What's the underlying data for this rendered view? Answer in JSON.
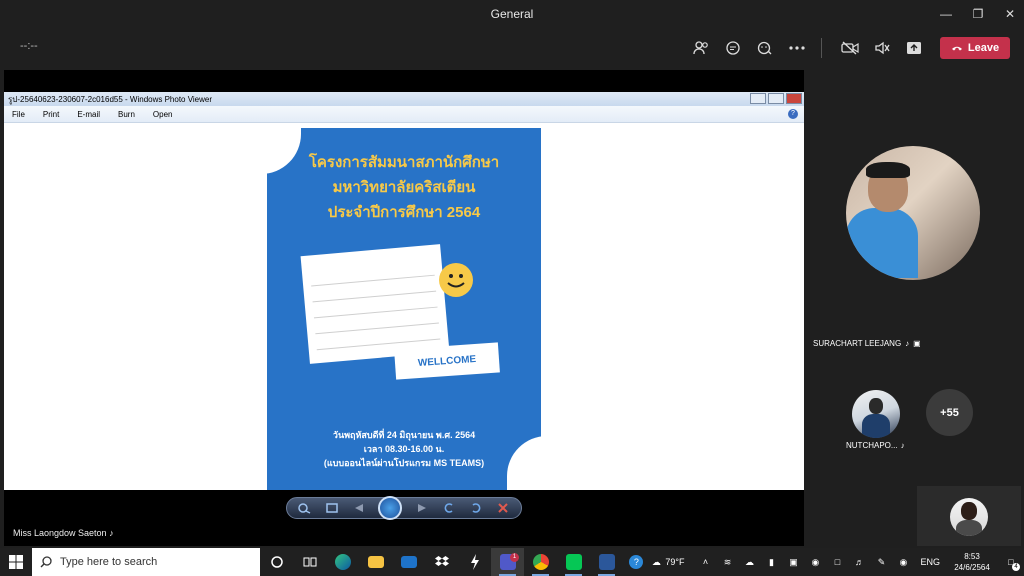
{
  "window": {
    "title": "General"
  },
  "meeting": {
    "timer": "--:--",
    "leave_label": "Leave"
  },
  "photo_viewer": {
    "title": "รูป-25640623-230607-2c016d55 - Windows Photo Viewer",
    "menu": [
      "File",
      "Print",
      "E-mail",
      "Burn",
      "Open"
    ]
  },
  "poster": {
    "title_lines": [
      "โครงการสัมมนาสภานักศึกษา",
      "มหาวิทยาลัยคริสเตียน",
      "ประจำปีการศึกษา 2564"
    ],
    "welcome": "WELLCOME",
    "footer_lines": [
      "วันพฤหัสบดีที่ 24 มิถุนายน พ.ศ. 2564",
      "เวลา 08.30-16.00 น.",
      "(แบบออนไลน์ผ่านโปรแกรม MS TEAMS)"
    ]
  },
  "presenter_name": "Miss Laongdow Saeton",
  "participants": {
    "main_name": "SURACHART LEEJANG",
    "second_name": "NUTCHAPO...",
    "more_count": "+55"
  },
  "taskbar": {
    "search_placeholder": "Type here to search",
    "weather": "79°F",
    "lang": "ENG",
    "time": "8:53",
    "date": "24/6/2564",
    "notif_count": "4",
    "teams_badge": "1"
  }
}
